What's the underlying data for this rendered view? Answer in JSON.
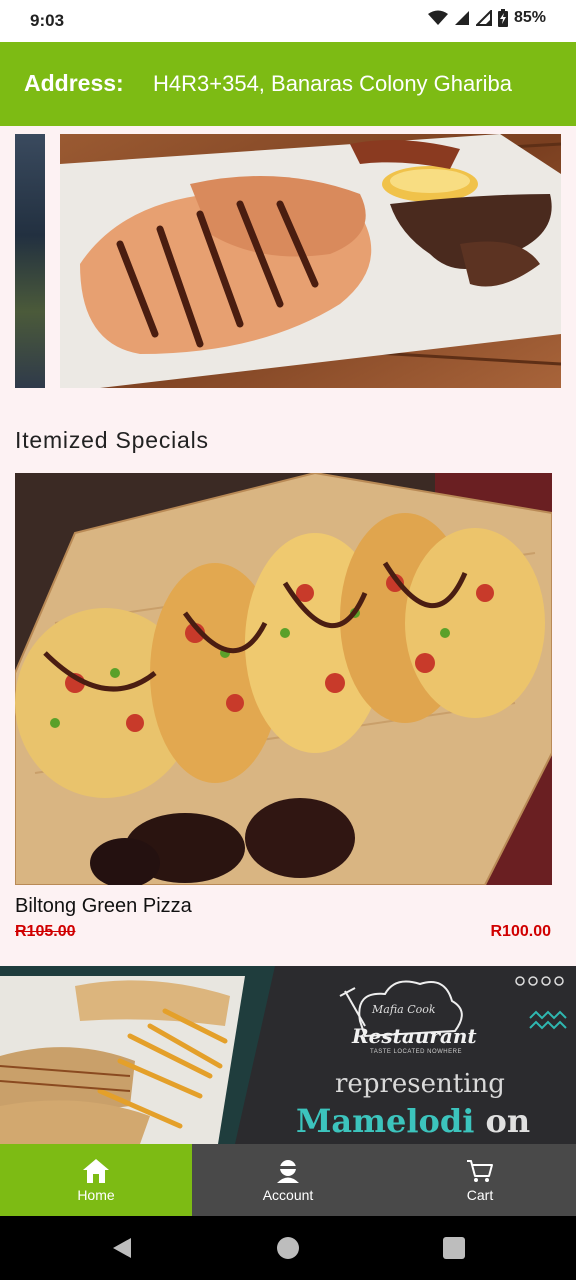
{
  "status_bar": {
    "time": "9:03",
    "battery": "85%"
  },
  "header": {
    "address_label": "Address:",
    "address_value": "H4R3+354, Banaras Colony Ghariba"
  },
  "sections": {
    "specials_title": "Itemized Specials"
  },
  "special_item": {
    "name": "Biltong Green Pizza",
    "old_price": "R105.00",
    "new_price": "R100.00"
  },
  "promo": {
    "brand_script": "Mafia Cook",
    "brand_name": "Restaurant",
    "tagline": "TASTE LOCATED NOWHERE",
    "line1": "representing",
    "line2": "Mamelodi",
    "line3": "on"
  },
  "bottom_nav": {
    "items": [
      {
        "label": "Home",
        "icon": "home-icon"
      },
      {
        "label": "Account",
        "icon": "account-icon"
      },
      {
        "label": "Cart",
        "icon": "cart-icon"
      }
    ]
  },
  "colors": {
    "brand_green": "#7dbb14",
    "nav_gray": "#494949",
    "price_red": "#d00000",
    "page_bg": "#fdf2f3"
  }
}
